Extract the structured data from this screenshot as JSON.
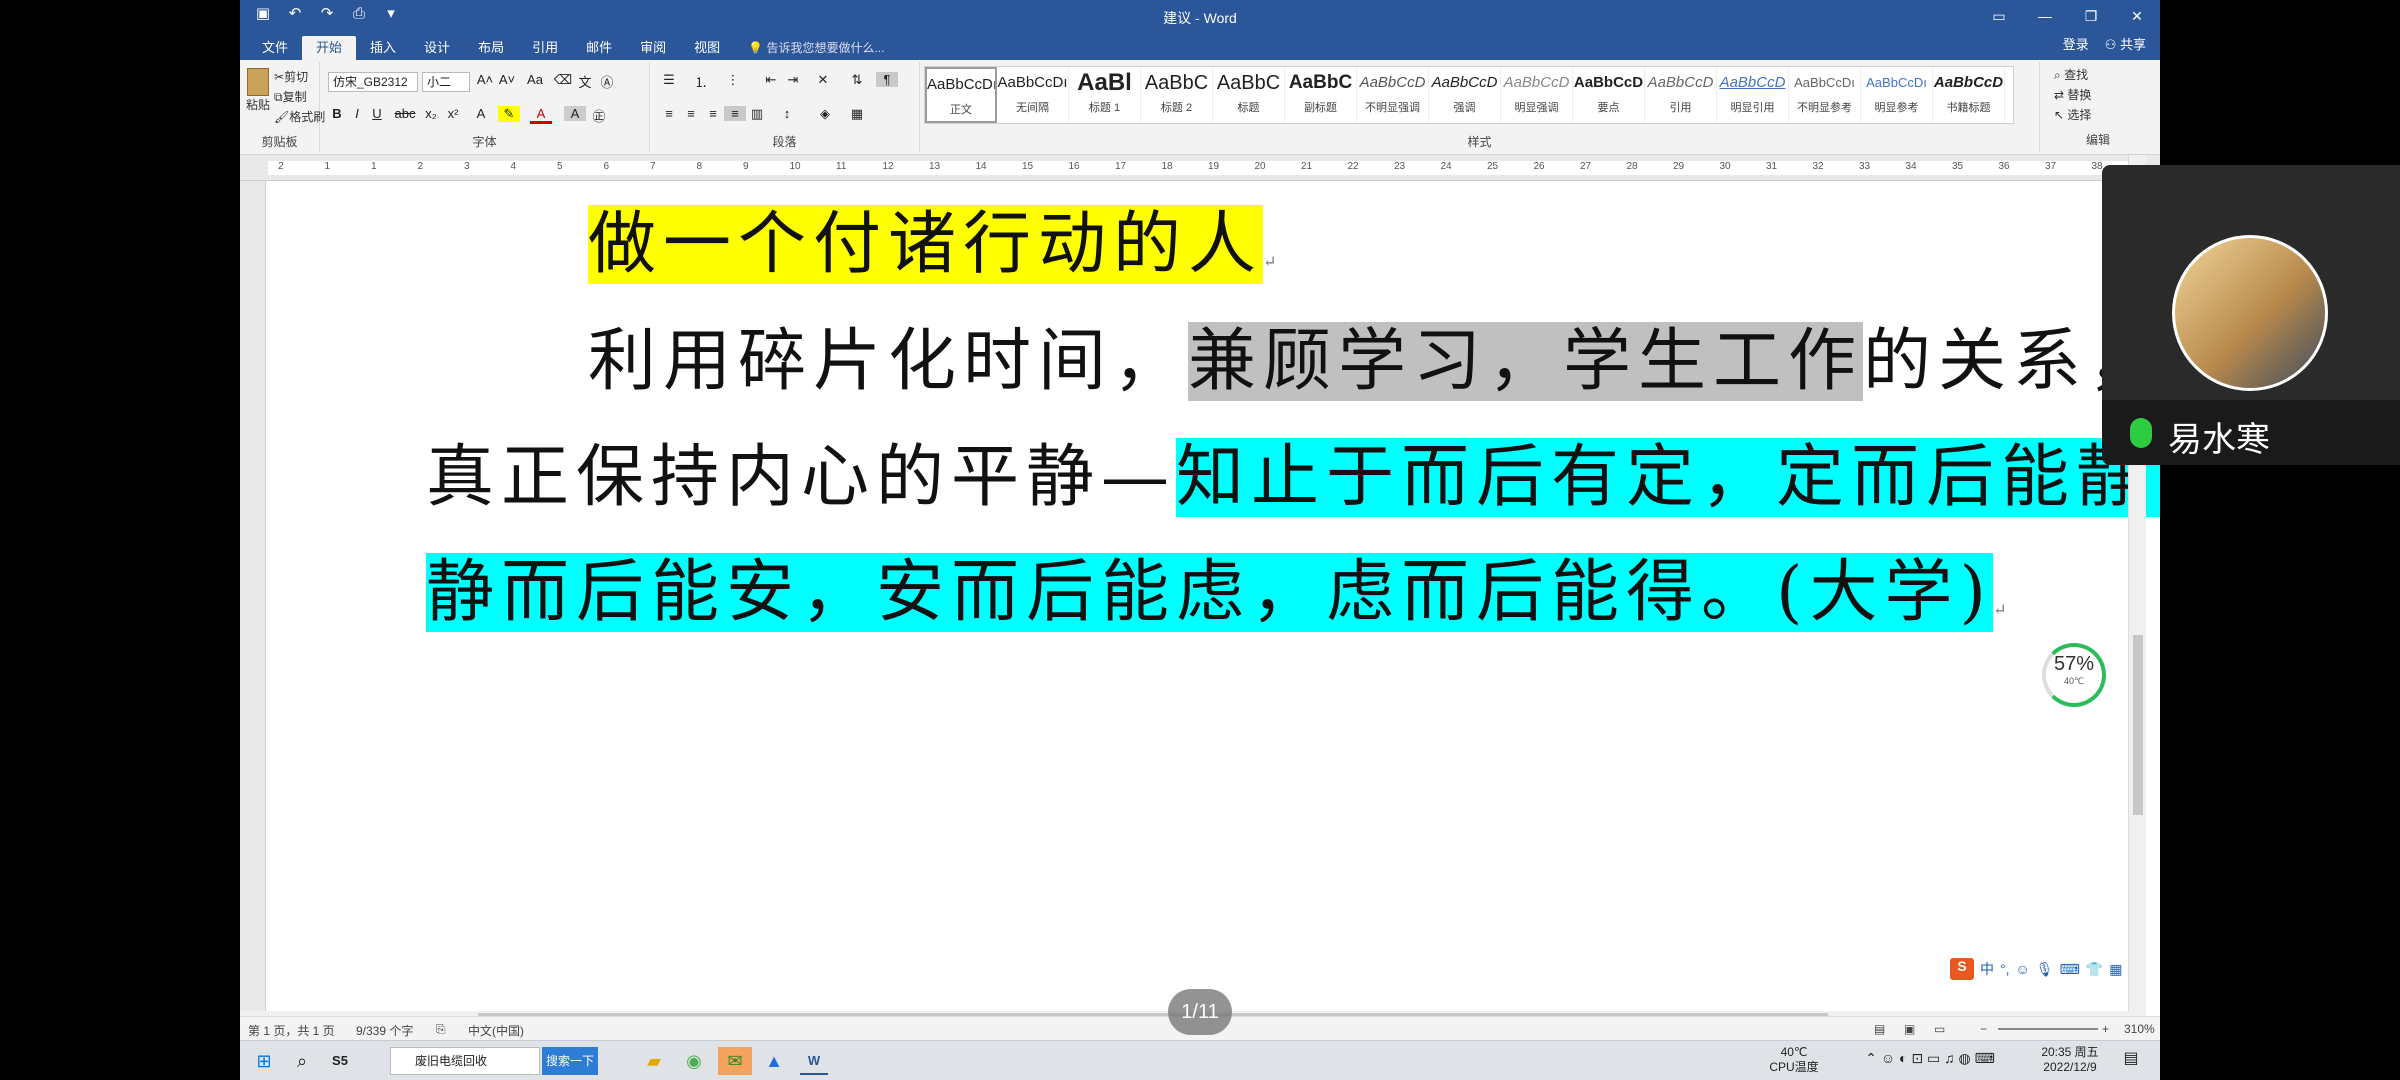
{
  "window": {
    "title": "建议 - Word"
  },
  "account": {
    "login": "登录",
    "share": "共享"
  },
  "tabs": [
    "文件",
    "开始",
    "插入",
    "设计",
    "布局",
    "引用",
    "邮件",
    "审阅",
    "视图"
  ],
  "tell_me": "告诉我您想要做什么...",
  "clipboard": {
    "paste": "粘贴",
    "cut": "剪切",
    "copy": "复制",
    "format_painter": "格式刷",
    "label": "剪贴板"
  },
  "font": {
    "name": "仿宋_GB2312",
    "size": "小二",
    "label": "字体"
  },
  "paragraph": {
    "label": "段落"
  },
  "styles": {
    "label": "样式",
    "items": [
      {
        "preview": "AaBbCcDı",
        "name": "正文"
      },
      {
        "preview": "AaBbCcDı",
        "name": "无间隔"
      },
      {
        "preview": "AaBl",
        "name": "标题 1"
      },
      {
        "preview": "AaBbC",
        "name": "标题 2"
      },
      {
        "preview": "AaBbC",
        "name": "标题"
      },
      {
        "preview": "AaBbC",
        "name": "副标题"
      },
      {
        "preview": "AaBbCcD",
        "name": "不明显强调"
      },
      {
        "preview": "AaBbCcD",
        "name": "强调"
      },
      {
        "preview": "AaBbCcD",
        "name": "明显强调"
      },
      {
        "preview": "AaBbCcD",
        "name": "要点"
      },
      {
        "preview": "AaBbCcD",
        "name": "引用"
      },
      {
        "preview": "AaBbCcD",
        "name": "明显引用"
      },
      {
        "preview": "AaBbCcDı",
        "name": "不明显参考"
      },
      {
        "preview": "AaBbCcDı",
        "name": "明显参考"
      },
      {
        "preview": "AaBbCcD",
        "name": "书籍标题"
      }
    ]
  },
  "editing": {
    "find": "查找",
    "replace": "替换",
    "select": "选择",
    "label": "编辑"
  },
  "document": {
    "title_line": "做一个付诸行动的人",
    "p2_plain_a": "利用碎片化时间，",
    "p2_gray": "兼顾学习，学生工作",
    "p2_plain_b": "的关系，",
    "p3_plain": "真正保持内心的平静—",
    "p3_cyan": "知止于而后有定，定而后能静，",
    "p4_cyan": "静而后能安，安而后能虑，虑而后能得。(大学)"
  },
  "ruler_numbers": [
    "2",
    "1",
    "1",
    "2",
    "3",
    "4",
    "5",
    "6",
    "7",
    "8",
    "9",
    "10",
    "11",
    "12",
    "13",
    "14",
    "15",
    "16",
    "17",
    "18",
    "19",
    "20",
    "21",
    "22",
    "23",
    "24",
    "25",
    "26",
    "27",
    "28",
    "29",
    "30",
    "31",
    "32",
    "33",
    "34",
    "35",
    "36",
    "37",
    "38"
  ],
  "status": {
    "page": "第 1 页，共 1 页",
    "words": "9/339 个字",
    "language": "中文(中国)",
    "zoom": "310%"
  },
  "overlays": {
    "speaker_name": "易水寒",
    "cpu_gauge": {
      "percent": "57%",
      "temp": "40℃"
    },
    "page_indicator": "1/11",
    "ime": {
      "logo": "S",
      "mode": "中"
    }
  },
  "taskbar": {
    "search_text": "废旧电缆回收",
    "search_button": "搜索一下",
    "cpu_temp": "40℃",
    "cpu_label": "CPU温度",
    "time": "20:35 周五",
    "date": "2022/12/9"
  }
}
